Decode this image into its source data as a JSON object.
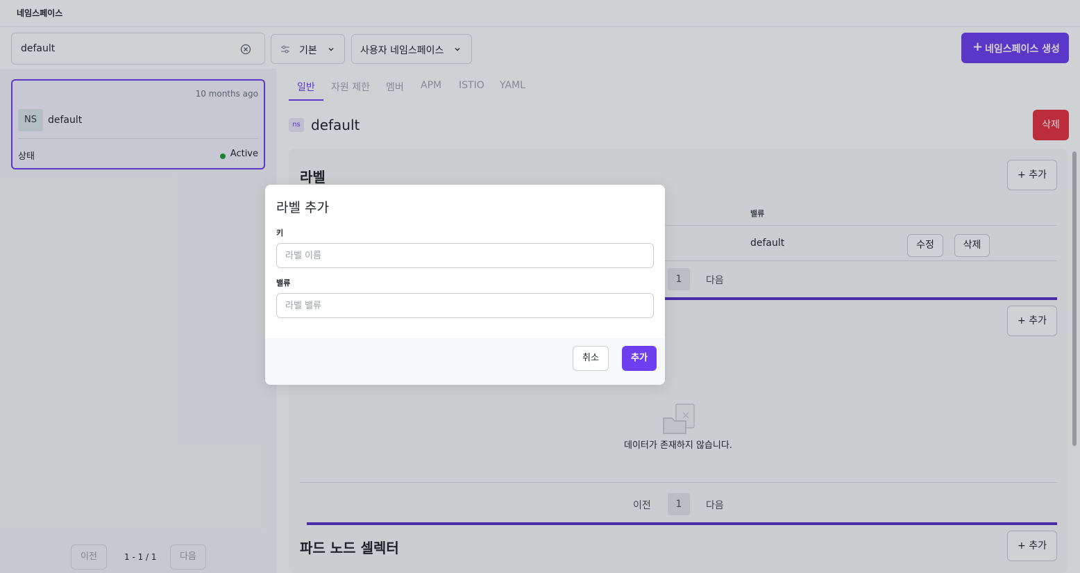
{
  "topbar": {
    "title": "네임스페이스"
  },
  "search": {
    "value": "default"
  },
  "filters": {
    "sort": {
      "label": "기본"
    },
    "type": {
      "label": "사용자 네임스페이스"
    }
  },
  "create_button": {
    "label": "네임스페이스 생성"
  },
  "namespace_list": {
    "items": [
      {
        "badge": "NS",
        "name": "default",
        "time": "10 months ago",
        "status_label": "상태",
        "status_value": "Active",
        "status_color": "#1f9d3c"
      }
    ],
    "pagination": {
      "prev": "이전",
      "info": "1 - 1 / 1",
      "next": "다음"
    }
  },
  "tabs": [
    {
      "label": "일반",
      "active": true
    },
    {
      "label": "자원 제한"
    },
    {
      "label": "멤버"
    },
    {
      "label": "APM"
    },
    {
      "label": "ISTIO"
    },
    {
      "label": "YAML"
    }
  ],
  "detail": {
    "icon_text": "ns",
    "title": "default",
    "delete_label": "삭제"
  },
  "labels_section": {
    "title": "라벨",
    "add_label": "+ 추가",
    "value_header": "밸류",
    "row": {
      "value": "default",
      "edit": "수정",
      "delete": "삭제"
    },
    "pagination": {
      "page": "1",
      "next": "다음"
    }
  },
  "annotations_section": {
    "add_label": "+ 추가",
    "empty_text": "데이터가 존재하지 않습니다.",
    "pagination": {
      "prev": "이전",
      "page": "1",
      "next": "다음"
    }
  },
  "node_selector_section": {
    "title": "파드 노드 셀렉터",
    "add_label": "+ 추가"
  },
  "modal": {
    "title": "라벨 추가",
    "key_label": "키",
    "key_placeholder": "라벨 이름",
    "value_label": "밸류",
    "value_placeholder": "라벨 밸류",
    "cancel": "취소",
    "submit": "추가"
  },
  "colors": {
    "accent": "#6d3ff0",
    "danger": "#e53343",
    "active": "#1f9d3c"
  }
}
